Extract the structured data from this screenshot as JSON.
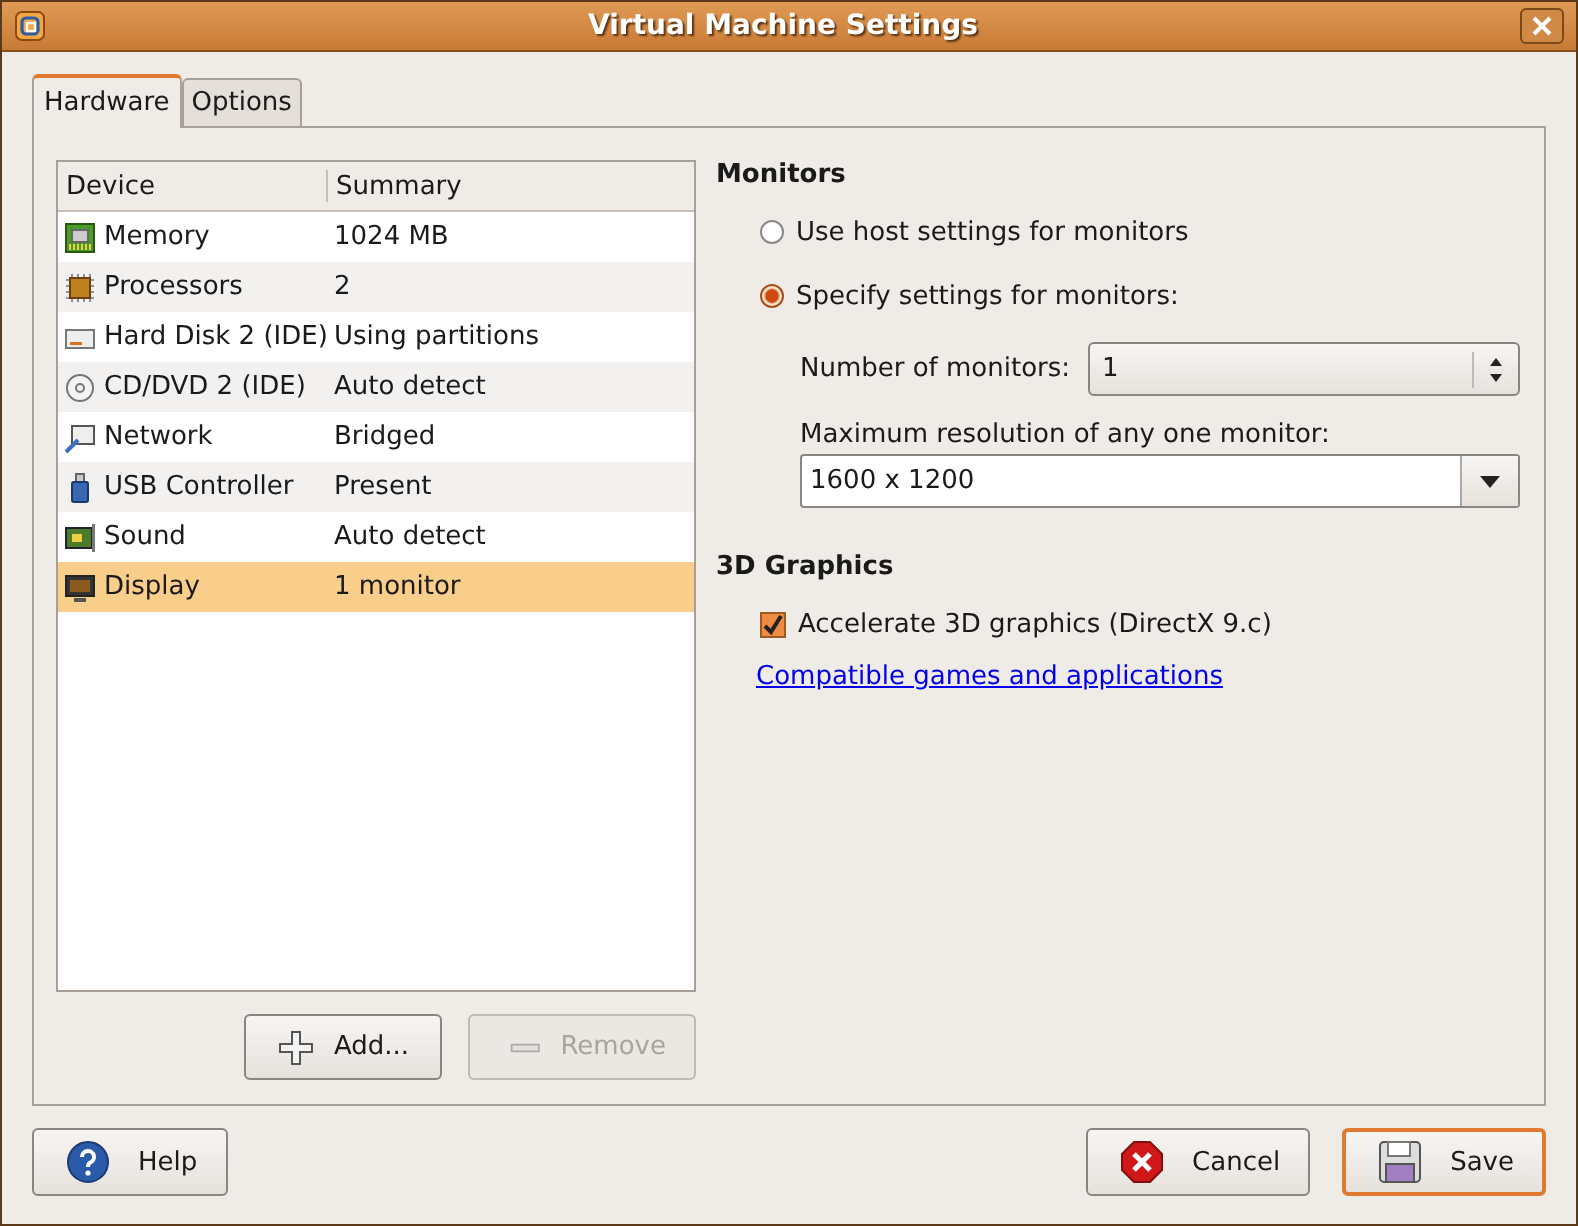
{
  "window": {
    "title": "Virtual Machine Settings"
  },
  "tabs": [
    {
      "label": "Hardware",
      "selected": true
    },
    {
      "label": "Options",
      "selected": false
    }
  ],
  "device_table": {
    "columns": [
      "Device",
      "Summary"
    ],
    "rows": [
      {
        "kind": "memory",
        "device": "Memory",
        "summary": "1024 MB",
        "selected": false
      },
      {
        "kind": "processor",
        "device": "Processors",
        "summary": "2",
        "selected": false
      },
      {
        "kind": "disk",
        "device": "Hard Disk 2 (IDE)",
        "summary": "Using partitions",
        "selected": false
      },
      {
        "kind": "cd",
        "device": "CD/DVD 2 (IDE)",
        "summary": "Auto detect",
        "selected": false
      },
      {
        "kind": "network",
        "device": "Network",
        "summary": "Bridged",
        "selected": false
      },
      {
        "kind": "usb",
        "device": "USB Controller",
        "summary": "Present",
        "selected": false
      },
      {
        "kind": "sound",
        "device": "Sound",
        "summary": "Auto detect",
        "selected": false
      },
      {
        "kind": "display",
        "device": "Display",
        "summary": "1 monitor",
        "selected": true
      }
    ]
  },
  "list_buttons": [
    {
      "kind": "add",
      "label": "Add...",
      "disabled": false
    },
    {
      "kind": "remove",
      "label": "Remove",
      "disabled": true
    }
  ],
  "monitors": {
    "heading": "Monitors",
    "options": [
      {
        "label": "Use host settings for monitors",
        "selected": false
      },
      {
        "label": "Specify settings for monitors:",
        "selected": true
      }
    ],
    "number_label": "Number of monitors:",
    "number_value": "1",
    "resolution_label": "Maximum resolution of any one monitor:",
    "resolution_value": "1600 x 1200"
  },
  "graphics": {
    "heading": "3D Graphics",
    "accelerate": {
      "label": "Accelerate 3D graphics (DirectX 9.c)",
      "checked": true
    },
    "link": "Compatible games and applications"
  },
  "dialog_buttons": [
    {
      "kind": "help",
      "label": "Help",
      "default": false
    },
    {
      "kind": "cancel",
      "label": "Cancel",
      "default": false
    },
    {
      "kind": "save",
      "label": "Save",
      "default": true
    }
  ]
}
